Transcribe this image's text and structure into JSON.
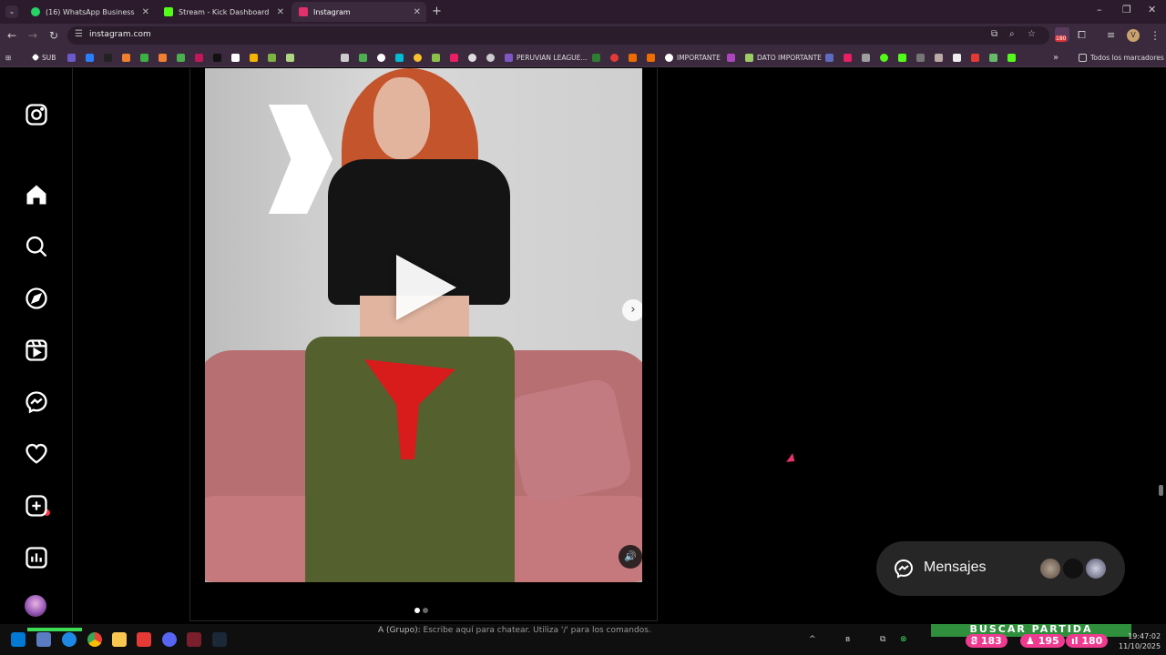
{
  "browser": {
    "tabs": [
      {
        "title": "(16) WhatsApp Business",
        "color": "#25d366"
      },
      {
        "title": "Stream - Kick Dashboard",
        "color": "#53fc18"
      },
      {
        "title": "Instagram",
        "color": "#e1306c"
      }
    ],
    "url": "instagram.com",
    "bookmarks": [
      "SUB",
      "PERUVIAN LEAGUE...",
      "IMPORTANTE",
      "DATO IMPORTANTE",
      "Todos los marcadores"
    ],
    "profile_initial": "V",
    "ext_badge": "180"
  },
  "instagram": {
    "sidebar_icons": [
      "instagram-logo-icon",
      "home-icon",
      "search-icon",
      "explore-icon",
      "reels-icon",
      "messenger-icon",
      "notifications-icon",
      "create-icon",
      "insights-icon"
    ],
    "messages_label": "Mensajes",
    "carousel": {
      "current": 1,
      "total": 2
    }
  },
  "overlay": {
    "chat_group": "A (Grupo):",
    "chat_placeholder": "Escribe aquí para chatear. Utiliza '/' para los comandos.",
    "game_banner": "BUSCAR PARTIDA",
    "stats": [
      "183",
      "195",
      "180"
    ]
  },
  "taskbar": {
    "time": "19:47:02",
    "date": "11/10/2025"
  }
}
